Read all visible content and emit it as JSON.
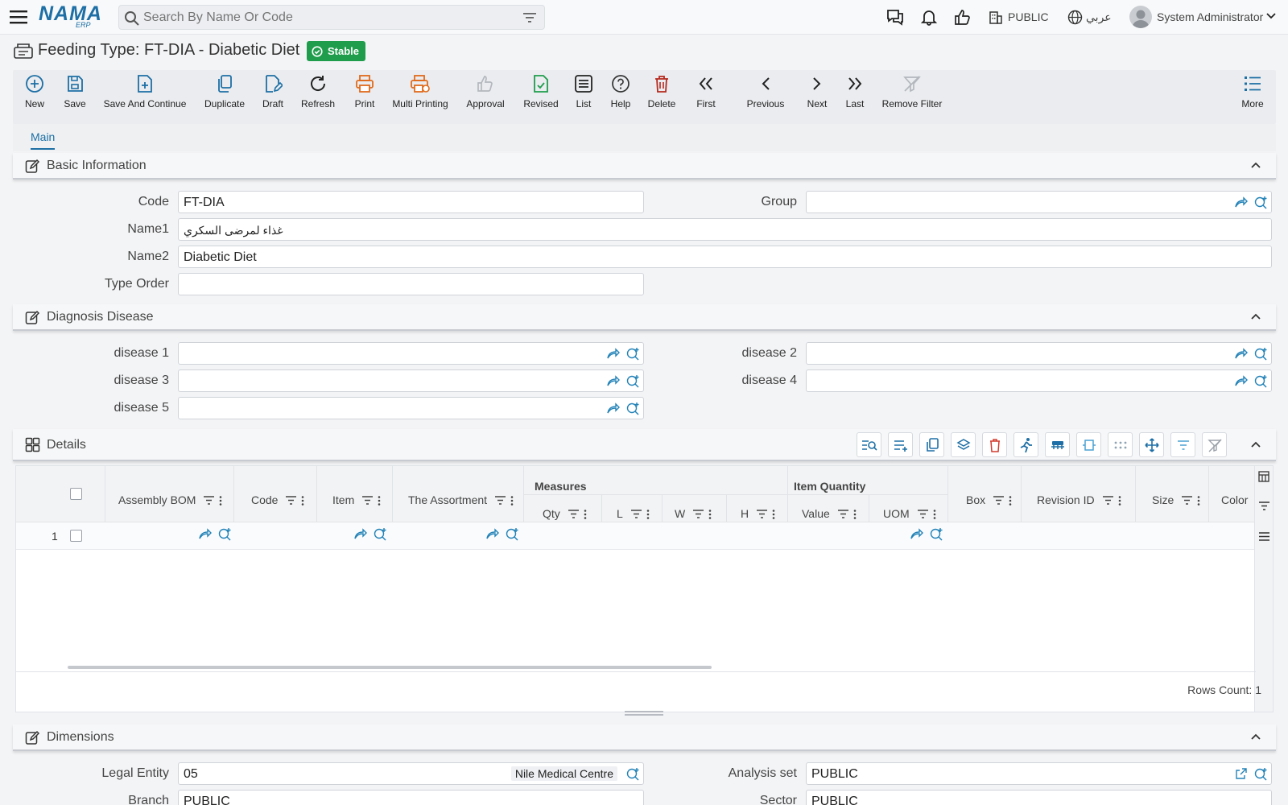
{
  "header": {
    "logo_main": "NAMA",
    "logo_sub": "ERP",
    "search_placeholder": "Search By Name Or Code",
    "branch": "PUBLIC",
    "language": "عربي",
    "user": "System Administrator"
  },
  "page": {
    "title": "Feeding Type: FT-DIA - Diabetic Diet",
    "status": "Stable"
  },
  "toolbar": [
    {
      "label": "New",
      "icon": "plus-circle-icon"
    },
    {
      "label": "Save",
      "icon": "save-icon"
    },
    {
      "label": "Save And Continue",
      "icon": "save-continue-icon"
    },
    {
      "label": "Duplicate",
      "icon": "duplicate-icon"
    },
    {
      "label": "Draft",
      "icon": "draft-icon"
    },
    {
      "label": "Refresh",
      "icon": "refresh-icon"
    },
    {
      "label": "Print",
      "icon": "print-icon"
    },
    {
      "label": "Multi Printing",
      "icon": "multi-print-icon"
    },
    {
      "label": "Approval",
      "icon": "thumbs-up-icon"
    },
    {
      "label": "Revised",
      "icon": "revised-icon"
    },
    {
      "label": "List",
      "icon": "list-icon"
    },
    {
      "label": "Help",
      "icon": "help-icon"
    },
    {
      "label": "Delete",
      "icon": "trash-icon"
    },
    {
      "label": "First",
      "icon": "first-icon"
    },
    {
      "label": "Previous",
      "icon": "previous-icon"
    },
    {
      "label": "Next",
      "icon": "next-icon"
    },
    {
      "label": "Last",
      "icon": "last-icon"
    },
    {
      "label": "Remove Filter",
      "icon": "remove-filter-icon"
    },
    {
      "label": "More",
      "icon": "more-icon"
    }
  ],
  "tabs": {
    "main": "Main"
  },
  "basic": {
    "title": "Basic Information",
    "code_label": "Code",
    "code_value": "FT-DIA",
    "group_label": "Group",
    "group_value": "",
    "name1_label": "Name1",
    "name1_value": "غذاء لمرضى السكري",
    "name2_label": "Name2",
    "name2_value": "Diabetic Diet",
    "type_order_label": "Type Order",
    "type_order_value": ""
  },
  "diagnosis": {
    "title": "Diagnosis Disease",
    "d1": "disease 1",
    "d2": "disease 2",
    "d3": "disease 3",
    "d4": "disease 4",
    "d5": "disease 5"
  },
  "details": {
    "title": "Details",
    "columns": {
      "assembly_bom": "Assembly BOM",
      "code": "Code",
      "item": "Item",
      "assortment": "The Assortment",
      "measures": "Measures",
      "qty": "Qty",
      "l": "L",
      "w": "W",
      "h": "H",
      "item_quantity": "Item Quantity",
      "value": "Value",
      "uom": "UOM",
      "box": "Box",
      "revision_id": "Revision ID",
      "size": "Size",
      "color": "Color"
    },
    "rows": [
      {
        "num": "1"
      }
    ],
    "rows_count": "Rows Count: 1"
  },
  "dimensions": {
    "title": "Dimensions",
    "legal_entity_label": "Legal Entity",
    "legal_entity_value": "05",
    "legal_entity_name": "Nile Medical Centre",
    "analysis_set_label": "Analysis set",
    "analysis_set_value": "PUBLIC",
    "branch_label": "Branch",
    "branch_value": "PUBLIC",
    "sector_label": "Sector",
    "sector_value": "PUBLIC"
  }
}
